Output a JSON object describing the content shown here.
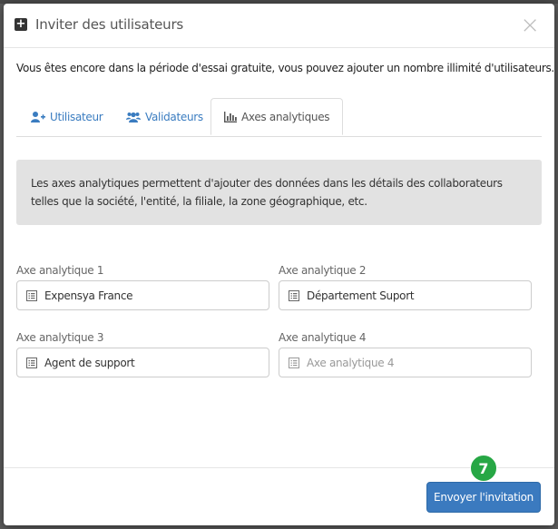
{
  "colors": {
    "accent": "#3b7abf",
    "tab_link": "#3a7cc0",
    "info_box_bg": "#e2e2e2",
    "step_badge": "#27a745"
  },
  "modal": {
    "title": "Inviter des utilisateurs",
    "title_icon": "plus-square-icon",
    "close_label": "×",
    "intro": "Vous êtes encore dans la période d'essai gratuite, vous pouvez ajouter un nombre illimité d'utilisateurs."
  },
  "tabs": [
    {
      "label": "Utilisateur",
      "icon": "user-plus-icon",
      "active": false
    },
    {
      "label": "Validateurs",
      "icon": "users-icon",
      "active": false
    },
    {
      "label": "Axes analytiques",
      "icon": "bar-chart-icon",
      "active": true
    }
  ],
  "info": {
    "text": "Les axes analytiques permettent d'ajouter des données dans les détails des collaborateurs telles que la société, l'entité, la filiale, la zone géographique, etc."
  },
  "fields": [
    {
      "label": "Axe analytique 1",
      "value": "Expensya France",
      "placeholder": "Axe analytique 1"
    },
    {
      "label": "Axe analytique 2",
      "value": "Département Suport",
      "placeholder": "Axe analytique 2"
    },
    {
      "label": "Axe analytique 3",
      "value": "Agent de support",
      "placeholder": "Axe analytique 3"
    },
    {
      "label": "Axe analytique 4",
      "value": "",
      "placeholder": "Axe analytique 4"
    }
  ],
  "footer": {
    "step_number": "7",
    "send_label": "Envoyer l'invitation"
  }
}
